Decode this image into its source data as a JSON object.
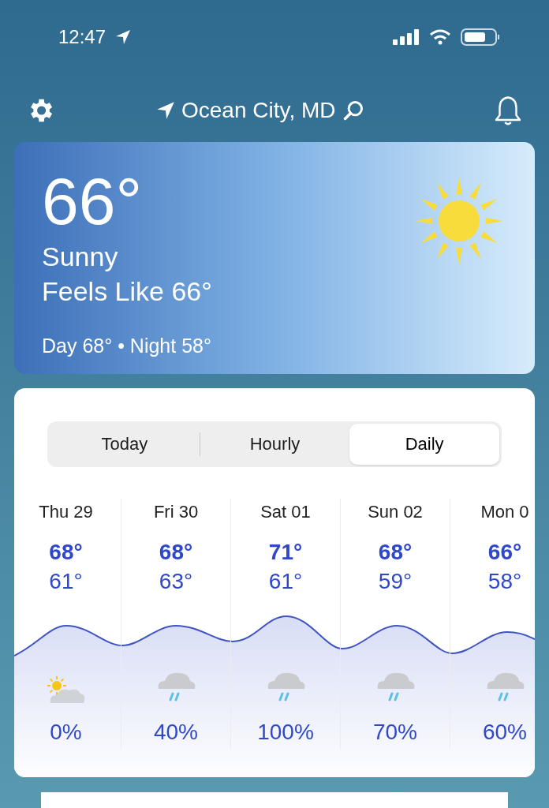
{
  "status_bar": {
    "time": "12:47"
  },
  "header": {
    "location": "Ocean City, MD"
  },
  "current": {
    "temperature": "66°",
    "condition": "Sunny",
    "feels_like": "Feels Like 66°",
    "day_night": "Day 68° • Night 58°"
  },
  "tabs": [
    {
      "label": "Today",
      "selected": false
    },
    {
      "label": "Hourly",
      "selected": false
    },
    {
      "label": "Daily",
      "selected": true
    }
  ],
  "days": [
    {
      "date": "Thu 29",
      "high": "68°",
      "low": "61°",
      "kind": "partly-sunny",
      "precip": "0%"
    },
    {
      "date": "Fri 30",
      "high": "68°",
      "low": "63°",
      "kind": "rain",
      "precip": "40%"
    },
    {
      "date": "Sat 01",
      "high": "71°",
      "low": "61°",
      "kind": "rain",
      "precip": "100%"
    },
    {
      "date": "Sun 02",
      "high": "68°",
      "low": "59°",
      "kind": "rain",
      "precip": "70%"
    },
    {
      "date": "Mon 0",
      "high": "66°",
      "low": "58°",
      "kind": "rain",
      "precip": "60%"
    }
  ]
}
